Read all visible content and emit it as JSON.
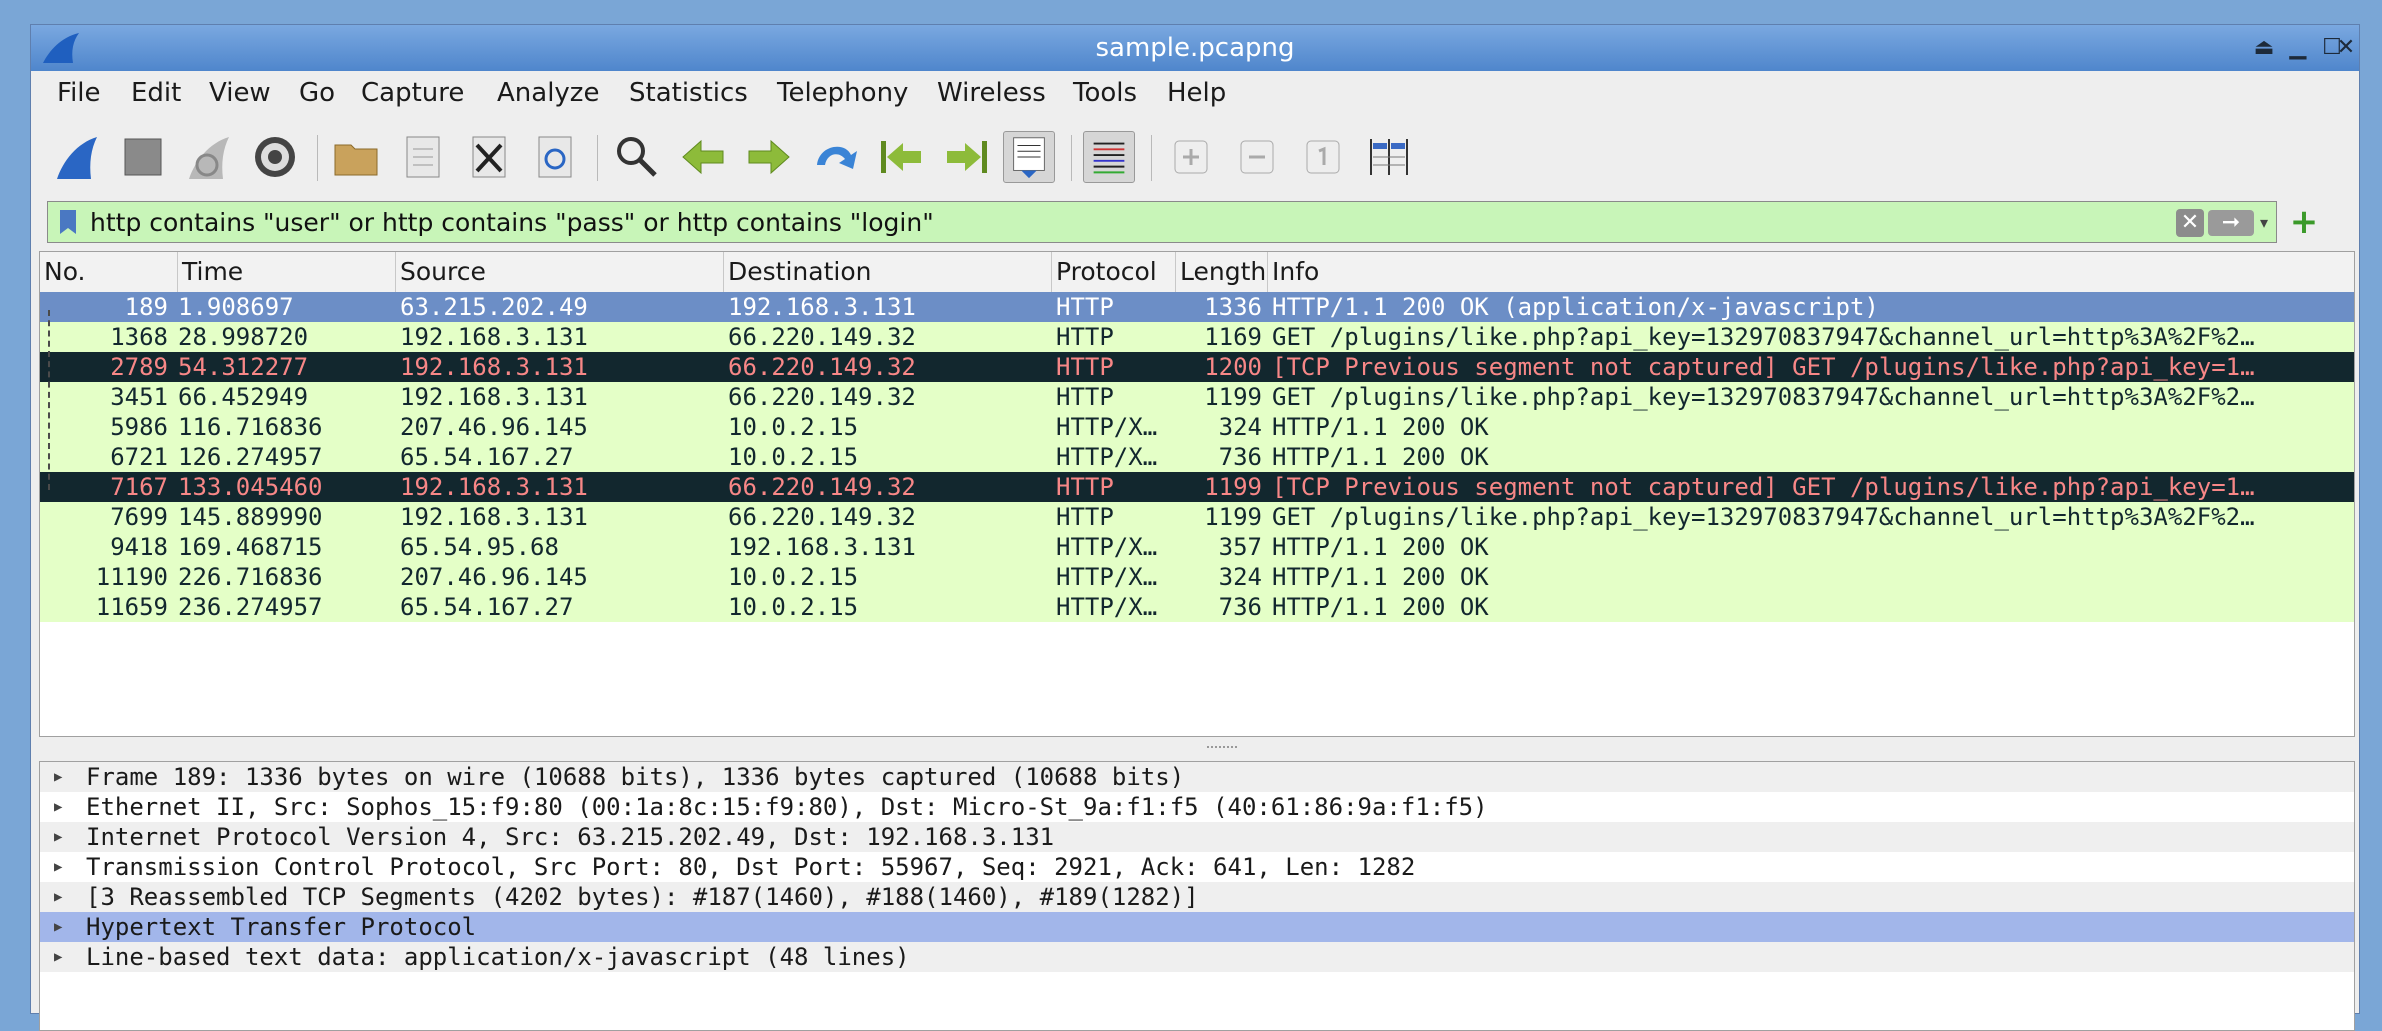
{
  "window": {
    "title": "sample.pcapng"
  },
  "menu": [
    "File",
    "Edit",
    "View",
    "Go",
    "Capture",
    "Analyze",
    "Statistics",
    "Telephony",
    "Wireless",
    "Tools",
    "Help"
  ],
  "toolbar": {
    "icons": [
      "shark-fin-start-icon",
      "stop-icon",
      "restart-capture-icon",
      "capture-options-icon",
      "open-file-icon",
      "save-file-icon",
      "close-file-icon",
      "reload-file-icon",
      "find-packet-icon",
      "go-back-icon",
      "go-forward-icon",
      "go-to-packet-icon",
      "first-packet-icon",
      "last-packet-icon",
      "autoscroll-icon",
      "colorize-icon",
      "zoom-in-icon",
      "zoom-out-icon",
      "normal-size-icon",
      "resize-columns-icon"
    ]
  },
  "filter": {
    "value": "http contains \"user\" or http contains \"pass\" or http contains \"login\"",
    "bg": "#c8f5b8"
  },
  "columns": [
    "No.",
    "Time",
    "Source",
    "Destination",
    "Protocol",
    "Length",
    "Info"
  ],
  "packets": [
    {
      "no": "189",
      "time": "1.908697",
      "src": "63.215.202.49",
      "dst": "192.168.3.131",
      "proto": "HTTP",
      "len": "1336",
      "info": "HTTP/1.1 200 OK  (application/x-javascript)",
      "style": "sel"
    },
    {
      "no": "1368",
      "time": "28.998720",
      "src": "192.168.3.131",
      "dst": "66.220.149.32",
      "proto": "HTTP",
      "len": "1169",
      "info": "GET /plugins/like.php?api_key=132970837947&channel_url=http%3A%2F%2…",
      "style": "http"
    },
    {
      "no": "2789",
      "time": "54.312277",
      "src": "192.168.3.131",
      "dst": "66.220.149.32",
      "proto": "HTTP",
      "len": "1200",
      "info": "[TCP Previous segment not captured] GET /plugins/like.php?api_key=1…",
      "style": "bad"
    },
    {
      "no": "3451",
      "time": "66.452949",
      "src": "192.168.3.131",
      "dst": "66.220.149.32",
      "proto": "HTTP",
      "len": "1199",
      "info": "GET /plugins/like.php?api_key=132970837947&channel_url=http%3A%2F%2…",
      "style": "http"
    },
    {
      "no": "5986",
      "time": "116.716836",
      "src": "207.46.96.145",
      "dst": "10.0.2.15",
      "proto": "HTTP/X…",
      "len": "324",
      "info": "HTTP/1.1 200 OK",
      "style": "http"
    },
    {
      "no": "6721",
      "time": "126.274957",
      "src": "65.54.167.27",
      "dst": "10.0.2.15",
      "proto": "HTTP/X…",
      "len": "736",
      "info": "HTTP/1.1 200 OK",
      "style": "http"
    },
    {
      "no": "7167",
      "time": "133.045460",
      "src": "192.168.3.131",
      "dst": "66.220.149.32",
      "proto": "HTTP",
      "len": "1199",
      "info": "[TCP Previous segment not captured] GET /plugins/like.php?api_key=1…",
      "style": "bad"
    },
    {
      "no": "7699",
      "time": "145.889990",
      "src": "192.168.3.131",
      "dst": "66.220.149.32",
      "proto": "HTTP",
      "len": "1199",
      "info": "GET /plugins/like.php?api_key=132970837947&channel_url=http%3A%2F%2…",
      "style": "http"
    },
    {
      "no": "9418",
      "time": "169.468715",
      "src": "65.54.95.68",
      "dst": "192.168.3.131",
      "proto": "HTTP/X…",
      "len": "357",
      "info": "HTTP/1.1 200 OK",
      "style": "http"
    },
    {
      "no": "11190",
      "time": "226.716836",
      "src": "207.46.96.145",
      "dst": "10.0.2.15",
      "proto": "HTTP/X…",
      "len": "324",
      "info": "HTTP/1.1 200 OK",
      "style": "http"
    },
    {
      "no": "11659",
      "time": "236.274957",
      "src": "65.54.167.27",
      "dst": "10.0.2.15",
      "proto": "HTTP/X…",
      "len": "736",
      "info": "HTTP/1.1 200 OK",
      "style": "http"
    }
  ],
  "details": [
    "Frame 189: 1336 bytes on wire (10688 bits), 1336 bytes captured (10688 bits)",
    "Ethernet II, Src: Sophos_15:f9:80 (00:1a:8c:15:f9:80), Dst: Micro-St_9a:f1:f5 (40:61:86:9a:f1:f5)",
    "Internet Protocol Version 4, Src: 63.215.202.49, Dst: 192.168.3.131",
    "Transmission Control Protocol, Src Port: 80, Dst Port: 55967, Seq: 2921, Ack: 641, Len: 1282",
    "[3 Reassembled TCP Segments (4202 bytes): #187(1460), #188(1460), #189(1282)]",
    "Hypertext Transfer Protocol",
    "Line-based text data: application/x-javascript (48 lines)"
  ],
  "colors": {
    "selected": "#6c8ec6",
    "http": "#e4ffc7",
    "bad_bg": "#12272e",
    "bad_fg": "#f78787",
    "detail_highlight": "#a2b6ea"
  }
}
